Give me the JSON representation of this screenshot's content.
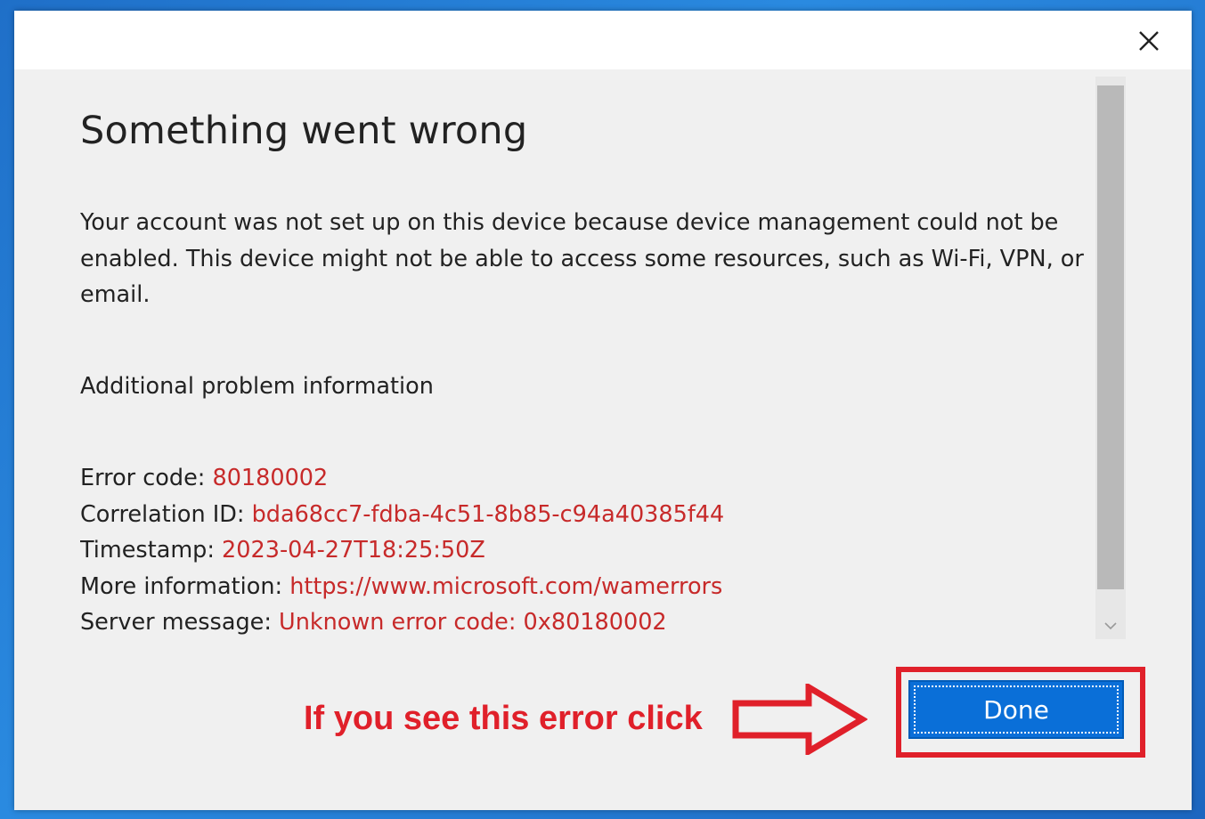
{
  "dialog": {
    "title": "Something went wrong",
    "message": "Your account was not set up on this device because device management could not be enabled. This device might not be able to access some resources, such as Wi-Fi, VPN, or email.",
    "additional_heading": "Additional problem information",
    "details": {
      "error_code_label": "Error code: ",
      "error_code": "80180002",
      "correlation_label": "Correlation ID: ",
      "correlation_id": "bda68cc7-fdba-4c51-8b85-c94a40385f44",
      "timestamp_label": "Timestamp: ",
      "timestamp": "2023-04-27T18:25:50Z",
      "more_info_label": "More information: ",
      "more_info_url": "https://www.microsoft.com/wamerrors",
      "server_message_label": "Server message: ",
      "server_message": "Unknown error code: 0x80180002"
    },
    "done_label": "Done",
    "close_icon": "close-icon",
    "scroll_icon": "chevron-down-icon"
  },
  "annotation": {
    "text": "If you see this error click",
    "arrow_icon": "right-arrow-icon",
    "color": "#e0202a"
  },
  "colors": {
    "value_red": "#c72a2a",
    "button_blue": "#0a6fd8",
    "dialog_bg": "#f0f0f0"
  }
}
